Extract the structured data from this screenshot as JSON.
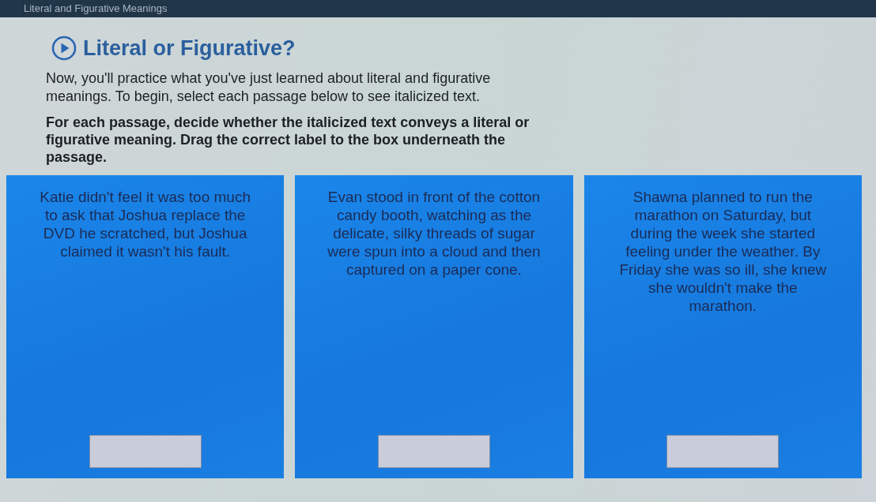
{
  "header": {
    "title": "Literal and Figurative Meanings"
  },
  "activity": {
    "title": "Literal or Figurative?",
    "paragraphs": [
      {
        "kind": "intro",
        "text": "Now, you'll practice what you've just learned about literal and figurative meanings. To begin, select each passage below to see italicized text."
      },
      {
        "kind": "instructions",
        "text": "For each passage, decide whether the italicized text conveys a literal or figurative meaning. Drag the correct label to the box underneath the passage."
      }
    ]
  },
  "passages": [
    {
      "text": "Katie didn't feel it was too much to ask that Joshua replace the DVD he scratched, but Joshua claimed it wasn't his fault."
    },
    {
      "text": "Evan stood in front of the cotton candy booth, watching as the delicate, silky threads of sugar were spun into a cloud and then captured on a paper cone."
    },
    {
      "text": "Shawna planned to run the marathon on Saturday, but during the week she started feeling under the weather. By Friday she was so ill, she knew she wouldn't make the marathon."
    }
  ]
}
